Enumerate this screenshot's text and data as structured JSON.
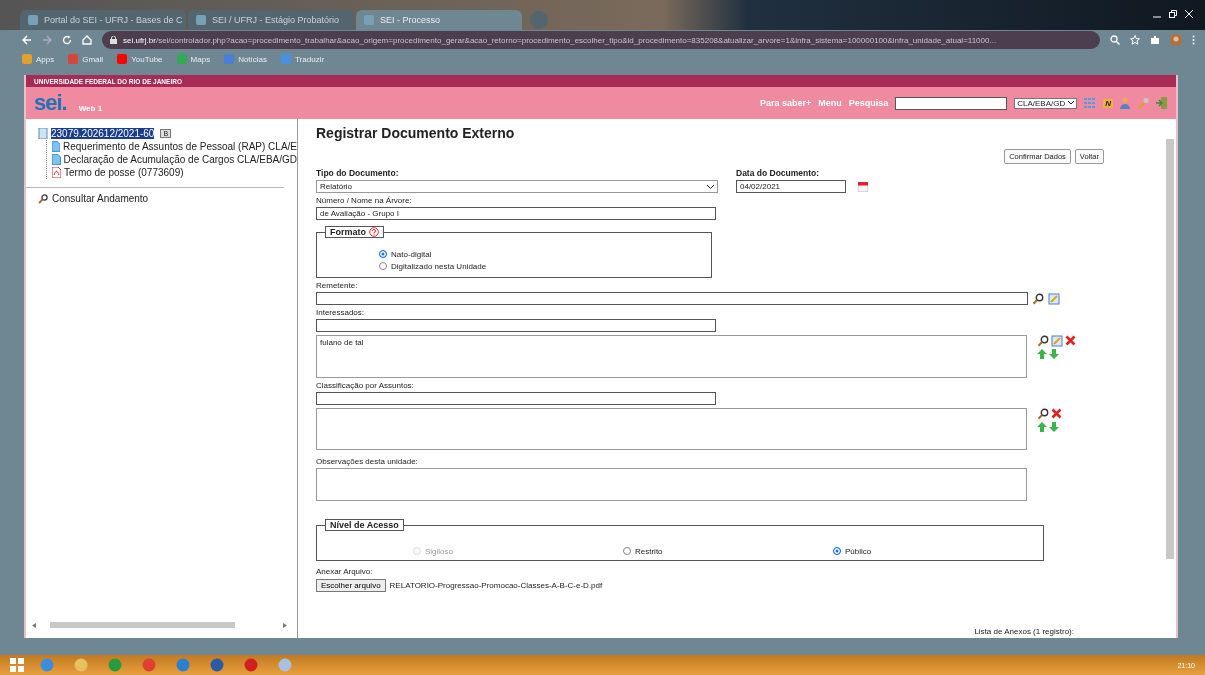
{
  "browser": {
    "tabs": [
      {
        "title": "Portal do SEI - UFRJ - Bases de C",
        "selected": false
      },
      {
        "title": "SEI / UFRJ - Estágio Probatório",
        "selected": false
      },
      {
        "title": "SEI - Processo",
        "selected": true
      }
    ],
    "url_host": "sei.ufrj.br",
    "url_path": "/sei/controlador.php?acao=procedimento_trabalhar&acao_origem=procedimento_gerar&acao_retorno=procedimento_escolher_tipo&id_procedimento=835208&atualizar_arvore=1&infra_sistema=100000100&infra_unidade_atual=11000...",
    "bookmarks": [
      {
        "label": "Apps",
        "color": "#e0a030"
      },
      {
        "label": "Gmail",
        "color": "#d44638"
      },
      {
        "label": "YouTube",
        "color": "#ff0000"
      },
      {
        "label": "Maps",
        "color": "#34a853"
      },
      {
        "label": "Notícias",
        "color": "#4a7fd8"
      },
      {
        "label": "Traduzir",
        "color": "#4a90e2"
      }
    ]
  },
  "header": {
    "institution": "UNIVERSIDADE FEDERAL DO RIO DE JANEIRO",
    "logo": "sei.",
    "subtitle": "Web 1",
    "links": [
      "Para saber+",
      "Menu",
      "Pesquisa"
    ],
    "unit": "CLA/EBA/GD",
    "badge": "N"
  },
  "tree": {
    "root": {
      "label": "23079.202612/2021-60",
      "selected": true,
      "badge": "B"
    },
    "children": [
      {
        "kind": "doc",
        "label": "Requerimento de Assuntos de Pessoal (RAP) CLA/E"
      },
      {
        "kind": "doc",
        "label": "Declaração de Acumulação de Cargos CLA/EBA/GD"
      },
      {
        "kind": "pdf",
        "label": "Termo de posse (0773609)"
      }
    ],
    "action": "Consultar Andamento"
  },
  "form": {
    "title": "Registrar Documento Externo",
    "buttons": [
      "Confirmar Dados",
      "Voltar"
    ],
    "tipo": {
      "label": "Tipo do Documento:",
      "value": "Relatório"
    },
    "data": {
      "label": "Data do Documento:",
      "value": "04/02/2021"
    },
    "numero": {
      "label": "Número / Nome na Árvore:",
      "value": "de Avaliação - Grupo I"
    },
    "formato": {
      "legend": "Formato",
      "options": [
        {
          "label": "Nato-digital",
          "selected": true,
          "disabled": false
        },
        {
          "label": "Digitalizado nesta Unidade",
          "selected": false,
          "disabled": false
        }
      ]
    },
    "remetente": {
      "label": "Remetente:"
    },
    "interessados": {
      "label": "Interessados:",
      "items": [
        "fulano de tal"
      ]
    },
    "classificacao": {
      "label": "Classificação por Assuntos:"
    },
    "observacoes": {
      "label": "Observações desta unidade:"
    },
    "nivel": {
      "legend": "Nível de Acesso",
      "options": [
        {
          "label": "Sigiloso",
          "selected": false,
          "disabled": true
        },
        {
          "label": "Restrito",
          "selected": false,
          "disabled": false
        },
        {
          "label": "Público",
          "selected": true,
          "disabled": false
        }
      ]
    },
    "anexar": {
      "label": "Anexar Arquivo:",
      "button": "Escolher arquivo",
      "filename": "RELATORIO-Progressao-Promocao-Classes-A-B-C-e-D.pdf"
    },
    "anexos": "Lista de Anexos (1 registro):"
  },
  "taskbar": {
    "clock": "21:10"
  }
}
